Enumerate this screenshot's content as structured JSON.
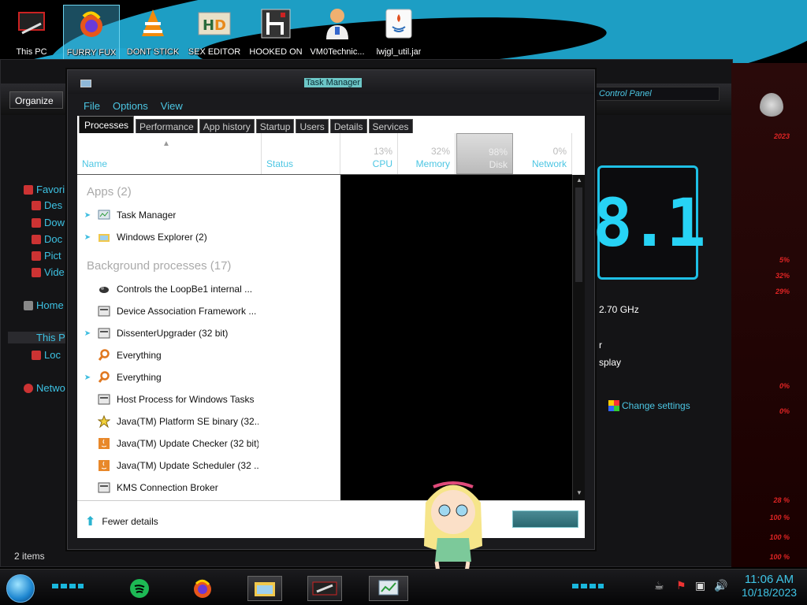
{
  "desktop": {
    "icons": [
      {
        "label": "This PC",
        "icon": "this-pc-icon"
      },
      {
        "label": "FURRY FUX",
        "icon": "firefox-icon"
      },
      {
        "label": "DONT STICK",
        "icon": "vlc-icon"
      },
      {
        "label": "SEX EDITOR",
        "icon": "hxd-icon"
      },
      {
        "label": "HOOKED ON",
        "icon": "game-icon"
      },
      {
        "label": "VM0Technic...",
        "icon": "doctor-icon"
      },
      {
        "label": "lwjgl_util.jar",
        "icon": "java-icon"
      }
    ]
  },
  "explorer": {
    "organize": "Organize",
    "control_panel": "Control Panel",
    "nav": [
      {
        "label": "Favori",
        "icon": "star-icon"
      },
      {
        "label": "Des",
        "icon": "desktop-icon"
      },
      {
        "label": "Dow",
        "icon": "downloads-icon"
      },
      {
        "label": "Doc",
        "icon": "documents-icon"
      },
      {
        "label": "Pict",
        "icon": "pictures-icon"
      },
      {
        "label": "Vide",
        "icon": "videos-icon"
      },
      {
        "label": "Home",
        "icon": "home-icon"
      },
      {
        "label": "This P",
        "icon": "this-pc-icon"
      },
      {
        "label": "Loc",
        "icon": "local-disk-icon"
      },
      {
        "label": "Netwo",
        "icon": "network-icon"
      }
    ],
    "big_version": "8.1",
    "cpu_speed": "2.70 GHz",
    "line_r": "r",
    "line_display": "splay",
    "change_settings": "Change settings",
    "status_items": "2 items"
  },
  "gadget": {
    "lines": [
      "2023",
      "5%",
      "32%",
      "29%",
      "0%",
      "0%",
      "28 %",
      "100 %",
      "100 %",
      "100 %"
    ]
  },
  "taskmgr": {
    "title": "Task Manager",
    "menu": [
      "File",
      "Options",
      "View"
    ],
    "tabs": [
      "Processes",
      "Performance",
      "App history",
      "Startup",
      "Users",
      "Details",
      "Services"
    ],
    "columns": {
      "name": "Name",
      "status": "Status",
      "cpu": {
        "pct": "13%",
        "label": "CPU"
      },
      "memory": {
        "pct": "32%",
        "label": "Memory"
      },
      "disk": {
        "pct": "98%",
        "label": "Disk"
      },
      "network": {
        "pct": "0%",
        "label": "Network"
      }
    },
    "groups": {
      "apps": "Apps (2)",
      "background": "Background processes (17)"
    },
    "apps": [
      {
        "name": "Task Manager",
        "expandable": true,
        "icon": "task-manager-icon"
      },
      {
        "name": "Windows Explorer (2)",
        "expandable": true,
        "icon": "explorer-icon"
      }
    ],
    "background": [
      {
        "name": "Controls the LoopBe1 internal ...",
        "expandable": false,
        "icon": "loopbe-icon"
      },
      {
        "name": "Device Association Framework ...",
        "expandable": false,
        "icon": "service-icon"
      },
      {
        "name": "DissenterUpgrader (32 bit)",
        "expandable": true,
        "icon": "service-icon"
      },
      {
        "name": "Everything",
        "expandable": false,
        "icon": "everything-icon"
      },
      {
        "name": "Everything",
        "expandable": true,
        "icon": "everything-icon"
      },
      {
        "name": "Host Process for Windows Tasks",
        "expandable": false,
        "icon": "service-icon"
      },
      {
        "name": "Java(TM) Platform SE binary (32...",
        "expandable": false,
        "icon": "java-star-icon"
      },
      {
        "name": "Java(TM) Update Checker (32 bit)",
        "expandable": false,
        "icon": "java-update-icon"
      },
      {
        "name": "Java(TM) Update Scheduler (32 ...",
        "expandable": false,
        "icon": "java-update-icon"
      },
      {
        "name": "KMS Connection Broker",
        "expandable": false,
        "icon": "service-icon"
      }
    ],
    "fewer_details": "Fewer details"
  },
  "taskbar": {
    "time": "11:06 AM",
    "date": "10/18/2023",
    "pinned": [
      "spotify-icon",
      "firefox-icon",
      "file-explorer-icon",
      "game-icon",
      "task-manager-icon"
    ]
  },
  "colors": {
    "accent": "#3dc2e3",
    "alien_red": "#e02424"
  }
}
